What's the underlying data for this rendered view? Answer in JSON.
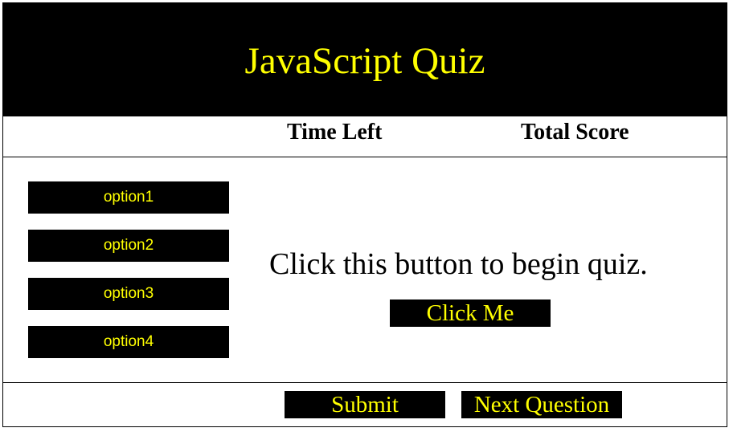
{
  "header": {
    "title": "JavaScript Quiz"
  },
  "status": {
    "time_left_label": "Time Left",
    "total_score_label": "Total Score"
  },
  "options": [
    {
      "label": "option1"
    },
    {
      "label": "option2"
    },
    {
      "label": "option3"
    },
    {
      "label": "option4"
    }
  ],
  "main": {
    "prompt": "Click this button to begin quiz.",
    "start_label": "Click Me"
  },
  "footer": {
    "submit_label": "Submit",
    "next_label": "Next Question"
  },
  "colors": {
    "background": "#000000",
    "accent_text": "#ffff00",
    "page": "#ffffff"
  }
}
